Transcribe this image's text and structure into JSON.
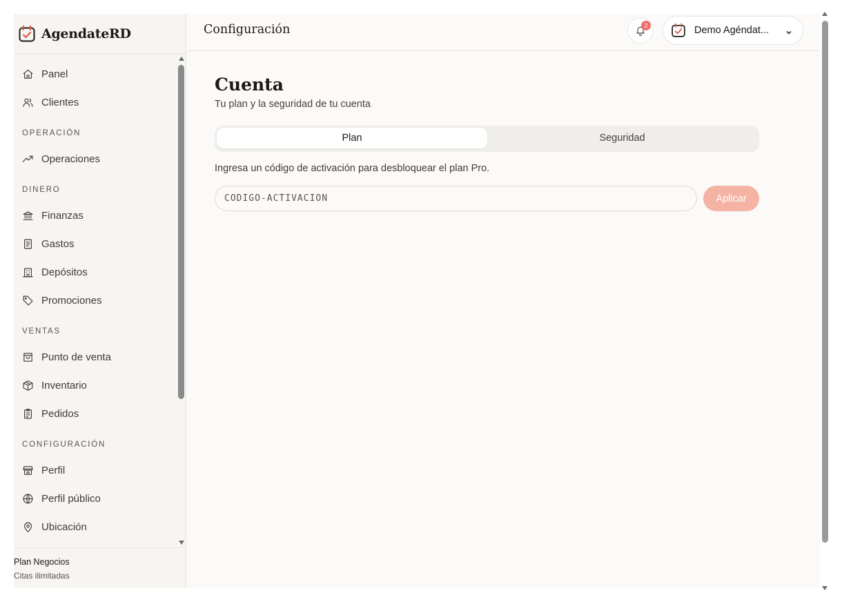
{
  "app": {
    "name": "AgendateRD",
    "brand_color": "#e05a47"
  },
  "header": {
    "title": "Configuración",
    "notifications_count": "2",
    "account_name": "Demo Agéndat..."
  },
  "sidebar": {
    "items_top": [
      {
        "label": "Panel",
        "icon": "home-icon"
      },
      {
        "label": "Clientes",
        "icon": "users-icon"
      }
    ],
    "sections": [
      {
        "title": "OPERACIÓN",
        "items": [
          {
            "label": "Operaciones",
            "icon": "trending-up-icon"
          }
        ]
      },
      {
        "title": "DINERO",
        "items": [
          {
            "label": "Finanzas",
            "icon": "bank-icon"
          },
          {
            "label": "Gastos",
            "icon": "receipt-icon"
          },
          {
            "label": "Depósitos",
            "icon": "building-icon"
          },
          {
            "label": "Promociones",
            "icon": "tag-icon"
          }
        ]
      },
      {
        "title": "VENTAS",
        "items": [
          {
            "label": "Punto de venta",
            "icon": "shopping-bag-icon"
          },
          {
            "label": "Inventario",
            "icon": "package-icon"
          },
          {
            "label": "Pedidos",
            "icon": "clipboard-icon"
          }
        ]
      },
      {
        "title": "CONFIGURACIÓN",
        "items": [
          {
            "label": "Perfil",
            "icon": "store-icon"
          },
          {
            "label": "Perfil público",
            "icon": "globe-icon"
          },
          {
            "label": "Ubicación",
            "icon": "map-pin-icon"
          }
        ]
      }
    ],
    "plan": {
      "name": "Plan Negocios",
      "subtitle": "Citas ilimitadas"
    }
  },
  "main": {
    "title": "Cuenta",
    "subtitle": "Tu plan y la seguridad de tu cuenta",
    "tabs": [
      {
        "label": "Plan",
        "active": true
      },
      {
        "label": "Seguridad",
        "active": false
      }
    ],
    "description": "Ingresa un código de activación para desbloquear el plan Pro.",
    "code_placeholder": "CÓDIGO-ACTIVACIÓN",
    "apply_label": "Aplicar"
  }
}
